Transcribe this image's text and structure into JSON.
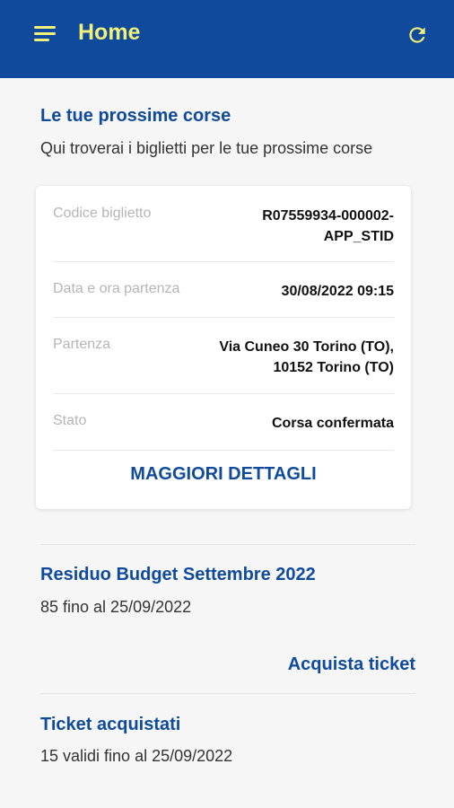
{
  "header": {
    "title": "Home",
    "menu_icon": "hamburger-menu-icon",
    "refresh_icon": "refresh-icon",
    "colors": {
      "bar": "#0f4a9c",
      "accent": "#f1f17a"
    }
  },
  "upcoming": {
    "title": "Le tue prossime corse",
    "subtitle": "Qui troverai i biglietti per le tue prossime corse",
    "card": {
      "rows": [
        {
          "label": "Codice biglietto",
          "value_line1": "R07559934-000002-",
          "value_line2": "APP_STID"
        },
        {
          "label": "Data e ora partenza",
          "value": "30/08/2022 09:15"
        },
        {
          "label": "Partenza",
          "value_line1": "Via Cuneo 30 Torino (TO),",
          "value_line2": "10152 Torino (TO)"
        },
        {
          "label": "Stato",
          "value": "Corsa confermata"
        }
      ],
      "details_label": "MAGGIORI DETTAGLI"
    }
  },
  "budget": {
    "title": "Residuo Budget Settembre 2022",
    "subtitle": "85 fino al 25/09/2022",
    "action_label": "Acquista ticket"
  },
  "tickets": {
    "title": "Ticket acquistati",
    "subtitle": "15 validi fino al 25/09/2022"
  }
}
